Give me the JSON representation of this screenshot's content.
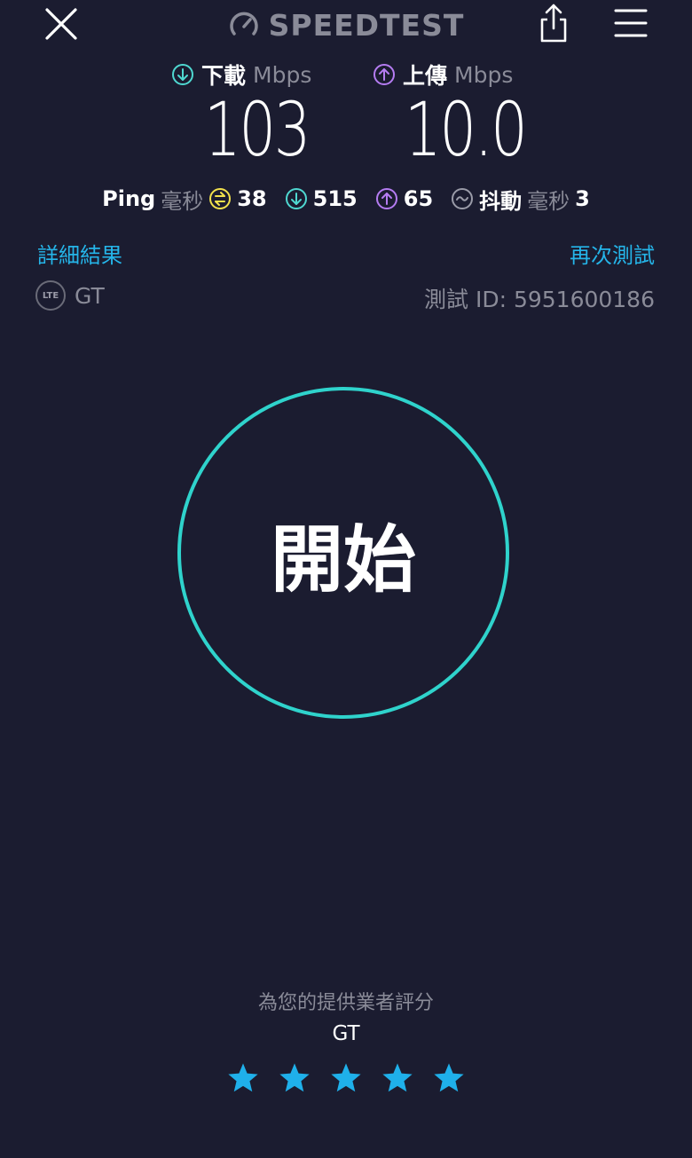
{
  "header": {
    "logo_text": "SPEEDTEST",
    "icons": [
      "close-icon",
      "speedometer-icon",
      "share-icon",
      "menu-icon"
    ]
  },
  "download": {
    "label": "下載",
    "unit": "Mbps",
    "value": "103"
  },
  "upload": {
    "label": "上傳",
    "unit": "Mbps",
    "value": "10.0"
  },
  "ping": {
    "label": "Ping",
    "unit": "毫秒",
    "idle": "38",
    "download": "515",
    "upload": "65"
  },
  "jitter": {
    "label": "抖動",
    "unit": "毫秒",
    "value": "3"
  },
  "links": {
    "details": "詳細結果",
    "retest": "再次測試"
  },
  "connection": {
    "network_badge": "LTE",
    "provider": "GT"
  },
  "test_id": "測試 ID: 5951600186",
  "go_button": {
    "label": "開始"
  },
  "rating": {
    "prompt": "為您的提供業者評分",
    "provider": "GT",
    "stars": 5
  },
  "colors": {
    "background": "#1b1c30",
    "download_accent": "#4fd8d1",
    "upload_accent": "#b57cf2",
    "ping_accent": "#f2e14c",
    "link": "#25b5e9",
    "ring": "#2fd3cc",
    "star": "#1fb0ea"
  }
}
